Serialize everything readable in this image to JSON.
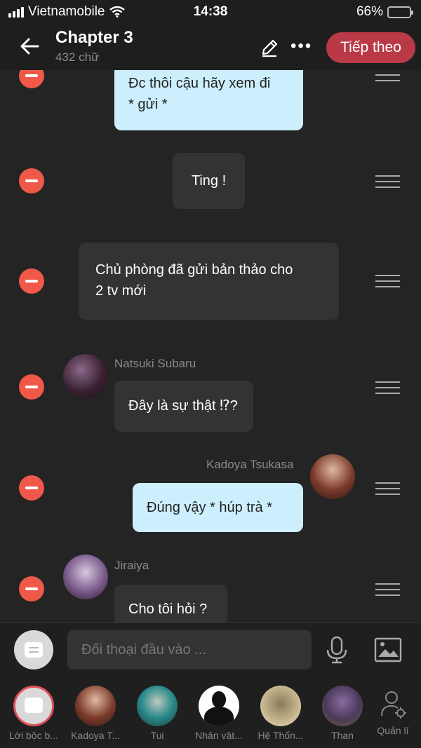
{
  "status_bar": {
    "carrier": "Vietnamobile",
    "time": "14:38",
    "battery": "66%",
    "battery_level": 0.66
  },
  "header": {
    "title": "Chapter 3",
    "word_count": "432 chữ",
    "next_label": "Tiếp theo"
  },
  "messages": [
    {
      "text_lines": [
        "Đc thôi cậu hãy xem đi",
        "* gửi *"
      ],
      "style": "blue"
    },
    {
      "text": "Ting !",
      "style": "narration"
    },
    {
      "text_lines": [
        "Chủ phòng đã gửi bản thảo cho",
        "2 tv mới"
      ],
      "style": "narration"
    },
    {
      "speaker": "Natsuki Subaru",
      "text": "Đây là sự thật ⁉?",
      "style": "dark"
    },
    {
      "speaker": "Kadoya Tsukasa",
      "text": "Đúng vậy * húp trà *",
      "style": "blue"
    },
    {
      "speaker": "Jiraiya",
      "text": "Cho tôi hỏi ?",
      "style": "dark"
    }
  ],
  "input": {
    "placeholder": "Đối thoại đầu vào ..."
  },
  "characters": [
    {
      "label": "Lời bộc b..."
    },
    {
      "label": "Kadoya T..."
    },
    {
      "label": "Tui"
    },
    {
      "label": "Nhân vật..."
    },
    {
      "label": "Hệ Thốn..."
    },
    {
      "label": "Than"
    }
  ],
  "manage_label": "Quản lí",
  "colors": {
    "accent": "#b93a46",
    "delete": "#f0584a",
    "blue_bubble": "#cdeffd",
    "dark_bubble": "#333333"
  }
}
